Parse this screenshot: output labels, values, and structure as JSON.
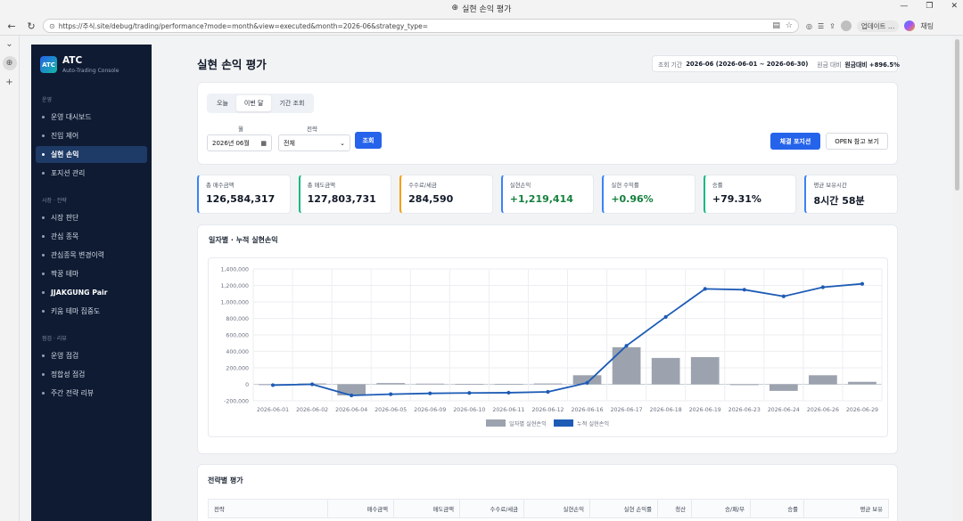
{
  "browser": {
    "window_title": "실현 손익 평가",
    "url": "https://주식.site/debug/trading/performance?mode=month&view=executed&month=2026-06&strategy_type=",
    "update_label": "업데이트 …",
    "chat_label": "채팅"
  },
  "sidebar": {
    "brand_logo": "ATC",
    "brand_title": "ATC",
    "brand_subtitle": "Auto-Trading Console",
    "sections": [
      {
        "title": "운영",
        "items": [
          "운영 대시보드",
          "진입 제어",
          "실현 손익",
          "포지션 관리"
        ]
      },
      {
        "title": "시장 · 전략",
        "items": [
          "시장 판단",
          "관심 종목",
          "관심종목 변경이력",
          "짝꿍 테마",
          "JJAKGUNG Pair",
          "키움 테마 집중도"
        ]
      },
      {
        "title": "점검 · 리뷰",
        "items": [
          "운영 점검",
          "정합성 점검",
          "주간 전략 리뷰"
        ]
      }
    ],
    "active_item": "실현 손익"
  },
  "page": {
    "title": "실현 손익 평가",
    "period_prefix": "조회 기간",
    "period_value": "2026-06 (2026-06-01 ~ 2026-06-30)",
    "principal_label": "원금 대비",
    "principal_value": "원금대비 +896.5%"
  },
  "filters": {
    "tabs": [
      "오늘",
      "이번 달",
      "기간 조회"
    ],
    "active_tab": "이번 달",
    "month_label": "월",
    "month_value": "2026년 06월",
    "strategy_label": "전략",
    "strategy_value": "전체",
    "search_button": "조회",
    "hold_button": "체결 포지션",
    "open_button": "OPEN 참고 보기"
  },
  "kpis": [
    {
      "label": "총 매수금액",
      "value": "126,584,317",
      "color": "#3b82f6",
      "tone": "normal"
    },
    {
      "label": "총 매도금액",
      "value": "127,803,731",
      "color": "#10b981",
      "tone": "normal"
    },
    {
      "label": "수수료/세금",
      "value": "284,590",
      "color": "#f59e0b",
      "tone": "normal"
    },
    {
      "label": "실현손익",
      "value": "+1,219,414",
      "color": "#3b82f6",
      "tone": "green"
    },
    {
      "label": "실현 수익률",
      "value": "+0.96%",
      "color": "#3b82f6",
      "tone": "green"
    },
    {
      "label": "승률",
      "value": "+79.31%",
      "color": "#10b981",
      "tone": "normal"
    },
    {
      "label": "평균 보유시간",
      "value": "8시간 58분",
      "color": "#3b82f6",
      "tone": "normal"
    }
  ],
  "chart_title": "일자별 · 누적 실현손익",
  "chart_data": {
    "type": "bar",
    "categories": [
      "2026-06-01",
      "2026-06-02",
      "2026-06-04",
      "2026-06-05",
      "2026-06-09",
      "2026-06-10",
      "2026-06-11",
      "2026-06-12",
      "2026-06-16",
      "2026-06-17",
      "2026-06-18",
      "2026-06-19",
      "2026-06-23",
      "2026-06-24",
      "2026-06-26",
      "2026-06-29"
    ],
    "series": [
      {
        "name": "일자별 실현손익",
        "type": "bar",
        "color": "#9ca3af",
        "values": [
          -10000,
          10000,
          -135000,
          15000,
          8000,
          5000,
          3000,
          10000,
          110000,
          450000,
          320000,
          330000,
          -10000,
          -80000,
          110000,
          30000
        ]
      },
      {
        "name": "누적 실현손익",
        "type": "line",
        "color": "#1d5bb5",
        "values": [
          -10000,
          0,
          -135000,
          -120000,
          -110000,
          -105000,
          -102000,
          -92000,
          18000,
          468000,
          818000,
          1158000,
          1148000,
          1068000,
          1178000,
          1219414
        ]
      }
    ],
    "ylim": [
      -200000,
      1400000
    ],
    "yticks": [
      "1,400,000",
      "1,200,000",
      "1,000,000",
      "800,000",
      "600,000",
      "400,000",
      "200,000",
      "0",
      "-200,000"
    ],
    "ytick_values": [
      1400000,
      1200000,
      1000000,
      800000,
      600000,
      400000,
      200000,
      0,
      -200000
    ],
    "legend_position": "bottom",
    "grid": true
  },
  "strategy_section": {
    "title": "전략별 평가",
    "columns": [
      "전략",
      "매수금액",
      "매도금액",
      "수수료/세금",
      "실현손익",
      "실현 손익률",
      "청산",
      "승/패/무",
      "승률",
      "평균 보유"
    ]
  }
}
